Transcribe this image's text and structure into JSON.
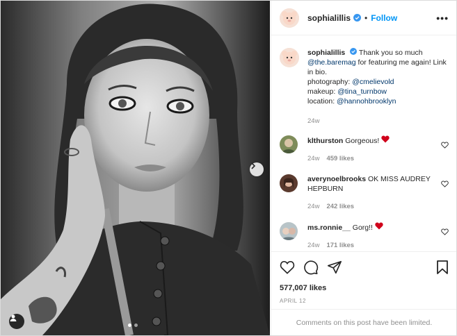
{
  "post": {
    "username": "sophialillis",
    "follow_label": "Follow",
    "separator": "•",
    "more_label": "•••"
  },
  "caption": {
    "username": "sophialillis",
    "text_1": "Thank you so much",
    "mention_1": "@the.baremag",
    "text_2": "for featuring me again! Link in bio.",
    "photography_label": "photography:",
    "photography_handle": "@cmelievold",
    "makeup_label": "makeup:",
    "makeup_handle": "@tina_turnbow",
    "location_label": "location:",
    "location_handle": "@hannohbrooklyn",
    "time": "24w"
  },
  "comments": [
    {
      "username": "klthurston",
      "text": "Gorgeous!",
      "heart": true,
      "time": "24w",
      "likes": "459 likes"
    },
    {
      "username": "averynoelbrooks",
      "text": "OK MISS AUDREY HEPBURN",
      "heart": false,
      "time": "24w",
      "likes": "242 likes"
    },
    {
      "username": "ms.ronnie__",
      "text": "Gorg!!",
      "heart": true,
      "time": "24w",
      "likes": "171 likes"
    }
  ],
  "stats": {
    "likes": "577,007 likes",
    "date": "APRIL 12"
  },
  "footer": {
    "limited_text": "Comments on this post have been limited."
  },
  "colors": {
    "accent": "#0095f6",
    "verified": "#3897f0",
    "heart": "#ed4956",
    "muted": "#8e8e8e"
  },
  "icons": [
    "verified-badge-icon",
    "more-icon",
    "chevron-right-icon",
    "user-tag-icon",
    "heart-icon",
    "comment-icon",
    "share-icon",
    "bookmark-icon"
  ]
}
